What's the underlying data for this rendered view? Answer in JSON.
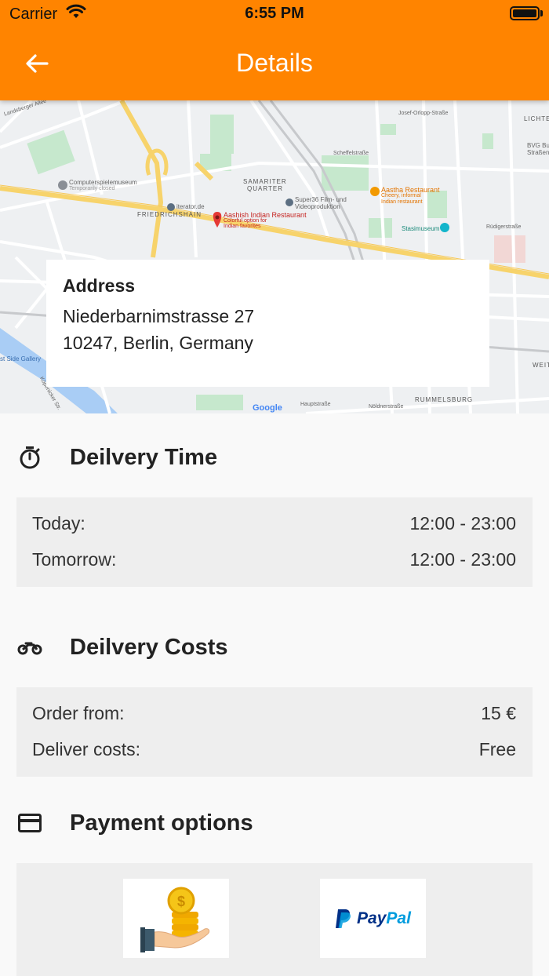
{
  "status_bar": {
    "carrier": "Carrier",
    "time": "6:55 PM"
  },
  "app_bar": {
    "title": "Details",
    "back_icon": "arrow-left-icon"
  },
  "map": {
    "labels": {
      "landsberger": "Landsberger Allee",
      "computerspiele": "Computerspielemuseum",
      "temp_closed": "Temporarily closed",
      "samariter": "SAMARITER",
      "quarter": "QUARTER",
      "friedrichshain": "FRIEDRICHSHAIN",
      "iterator": "iterator.de",
      "super36a": "Super36 Film- und",
      "super36b": "Videoproduktion",
      "aashish": "Aashish Indian Restaurant",
      "aashish_sub1": "Colorful option for",
      "aashish_sub2": "Indian favorites",
      "aastha": "Aastha Restaurant",
      "aastha_sub1": "Cheery, informal",
      "aastha_sub2": "Indian restaurant",
      "stasimuseum": "Stasimuseum",
      "lichten": "LICHTEN",
      "bvg1": "BVG Bus",
      "bvg2": "Straßenba",
      "rummelsburg": "RUMMELSBURG",
      "weite": "WEITE",
      "eastside": "st Side Gallery",
      "google": "Google",
      "josef": "Josef-Orlopp-Straße",
      "scheffel": "Scheffelstraße",
      "rudiger": "Rüdigerstraße",
      "haupt": "Hauptstraße",
      "nold": "Nöldnerstraße",
      "kopenicker": "Köpenicker Str."
    }
  },
  "address": {
    "title": "Address",
    "line1": "Niederbarnimstrasse 27",
    "line2": "10247, Berlin, Germany"
  },
  "delivery_time": {
    "icon": "stopwatch-icon",
    "title": "Deilvery Time",
    "rows": [
      {
        "label": "Today:",
        "value": "12:00 - 23:00"
      },
      {
        "label": "Tomorrow:",
        "value": "12:00 - 23:00"
      }
    ]
  },
  "delivery_costs": {
    "icon": "motorcycle-icon",
    "title": "Deilvery Costs",
    "rows": [
      {
        "label": "Order from:",
        "value": "15 €"
      },
      {
        "label": "Deliver costs:",
        "value": "Free"
      }
    ]
  },
  "payment": {
    "icon": "credit-card-icon",
    "title": "Payment options",
    "options": [
      {
        "name": "cash-icon"
      },
      {
        "name": "paypal-logo",
        "text": "PayPal"
      }
    ]
  },
  "colors": {
    "accent": "#ff8400",
    "box": "#eeeeee",
    "background": "#f9f9f9"
  }
}
